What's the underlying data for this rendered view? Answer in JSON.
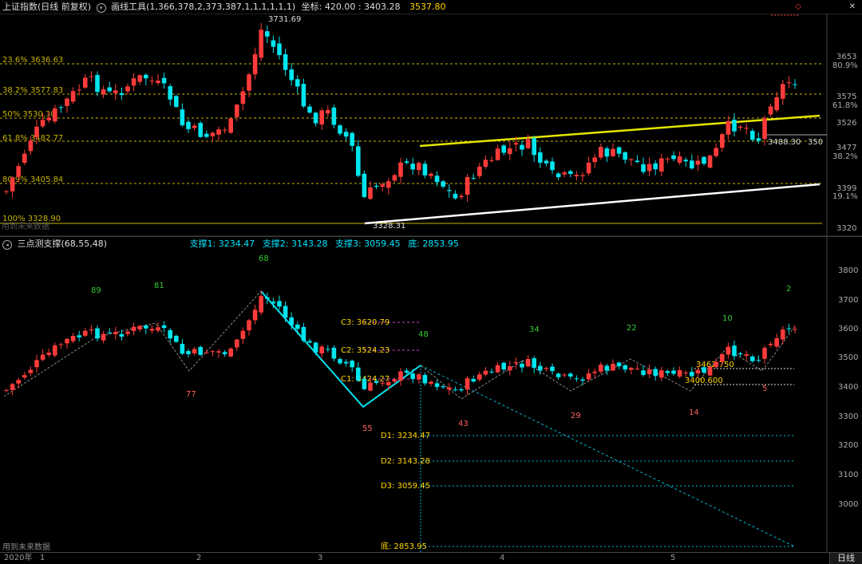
{
  "top_panel": {
    "title": "上证指数(日线 前复权)",
    "tool_label": "画线工具(1,366,378,2,373,387,1,1,1,1,1,1)",
    "coord_label": "坐标: 420.00 : 3403.28",
    "price_label": "3537.80",
    "high_annotation": "3731.69",
    "low_annotation": "3328.31",
    "right_annotation": "3488.30",
    "right_annotation_suffix": "350",
    "fib_levels": [
      {
        "label": "23.6% 3636.63",
        "pct": "80.9%",
        "price": 3636.63
      },
      {
        "label": "38.2% 3577.83",
        "pct": "61.8%",
        "price": 3577.83
      },
      {
        "label": "50% 3530.30",
        "pct": "",
        "price": 3530.3
      },
      {
        "label": "61.8% 3482.77",
        "pct": "38.2%",
        "price": 3482.77
      },
      {
        "label": "80.9% 3405.84",
        "pct": "19.1%",
        "price": 3405.84
      },
      {
        "label": "100% 3328.90",
        "pct": "",
        "price": 3328.9
      }
    ],
    "axis_ticks": [
      "3653",
      "3575",
      "3526",
      "3477",
      "3399",
      "3320"
    ],
    "faded_label": "用到未来数据"
  },
  "bottom_panel": {
    "title": "三点测支撑(68,55,48)",
    "support_labels": [
      {
        "label": "支撑1: 3234.47",
        "color": "#00e5ff"
      },
      {
        "label": "支撑2: 3143.28",
        "color": "#00e5ff"
      },
      {
        "label": "支撑3: 3059.45",
        "color": "#00e5ff"
      },
      {
        "label": "底: 2853.95",
        "color": "#00e5ff"
      }
    ],
    "c_levels": [
      {
        "label": "C3: 3620.79"
      },
      {
        "label": "C2: 3524.23"
      },
      {
        "label": "C1: 3424.27"
      }
    ],
    "d_levels": [
      {
        "label": "D1: 3234.47"
      },
      {
        "label": "D2: 3143.28"
      },
      {
        "label": "D3: 3059.45"
      },
      {
        "label": "底: 2853.95"
      }
    ],
    "box_labels": [
      "3462.750",
      "3400.600"
    ],
    "counts_green": [
      "89",
      "81",
      "68",
      "48",
      "34",
      "22",
      "10",
      "2"
    ],
    "counts_red": [
      "77",
      "55",
      "43",
      "29",
      "14",
      "5"
    ],
    "axis_ticks": [
      "3800",
      "3700",
      "3600",
      "3500",
      "3400",
      "3300",
      "3200",
      "3100",
      "3000"
    ],
    "future_data_label": "用到未来数据"
  },
  "time_axis": {
    "labels": [
      "2020年",
      "1",
      "2",
      "3",
      "4",
      "5"
    ],
    "period": "日线"
  },
  "colors": {
    "up": "#ff3b3b",
    "down": "#00e5ee",
    "fib": "#c8b400",
    "trend_upper": "#e6e600",
    "trend_lower": "#ffffff"
  },
  "icons": [
    "circle-arrow-down-icon",
    "circle-arrow-left-icon",
    "more-icon",
    "diamond-icon",
    "close-icon"
  ]
}
